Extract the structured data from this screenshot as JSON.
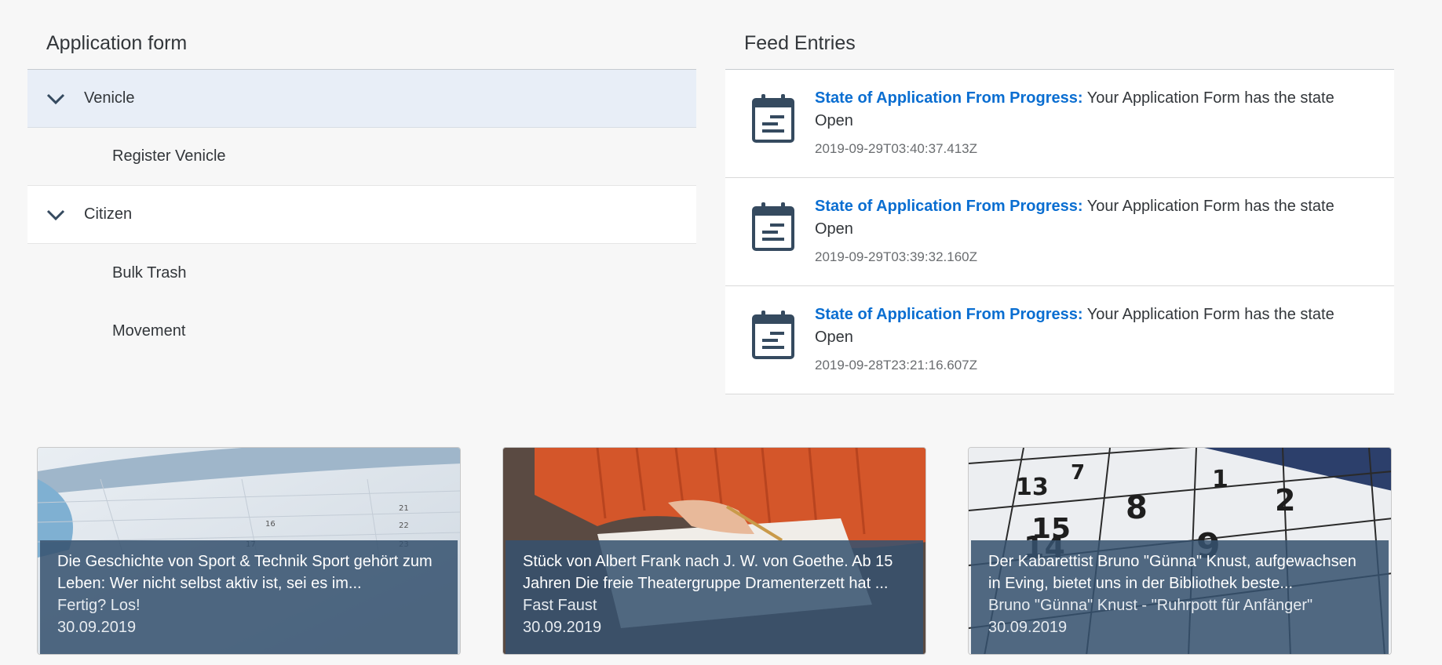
{
  "application_form": {
    "title": "Application form",
    "groups": [
      {
        "label": "Venicle",
        "icon": "chevron-down-icon",
        "items": [
          "Register Venicle"
        ]
      },
      {
        "label": "Citizen",
        "icon": "chevron-down-icon",
        "items": [
          "Bulk Trash",
          "Movement"
        ]
      }
    ]
  },
  "feed": {
    "title": "Feed Entries",
    "entries": [
      {
        "icon": "calendar-icon",
        "sender": "State of Application From Progress:",
        "text": "Your Application Form has the state Open",
        "timestamp": "2019-09-29T03:40:37.413Z"
      },
      {
        "icon": "calendar-icon",
        "sender": "State of Application From Progress:",
        "text": "Your Application Form has the state Open",
        "timestamp": "2019-09-29T03:39:32.160Z"
      },
      {
        "icon": "calendar-icon",
        "sender": "State of Application From Progress:",
        "text": "Your Application Form has the state Open",
        "timestamp": "2019-09-28T23:21:16.607Z"
      }
    ]
  },
  "tiles": [
    {
      "header": "Die Geschichte von Sport & Technik Sport gehört zum Leben: Wer nicht selbst aktiv ist, sei es im...",
      "subheader": "Fertig? Los!",
      "date": "30.09.2019",
      "image": "calendar-page-photo"
    },
    {
      "header": "Stück von Albert Frank nach J. W. von Goethe. Ab 15 Jahren Die freie Theatergruppe Dramenterzett hat ...",
      "subheader": "Fast Faust",
      "date": "30.09.2019",
      "image": "person-writing-photo"
    },
    {
      "header": "Der Kabarettist Bruno \"Günna\" Knust, aufgewachsen in Eving, bietet uns in der Bibliothek beste...",
      "subheader": "Bruno \"Günna\" Knust - \"Ruhrpott für Anfänger\"",
      "date": "30.09.2019",
      "image": "calendar-numbers-photo"
    }
  ],
  "colors": {
    "accent_blue": "#0a6ed1",
    "icon_blue": "#354a5f",
    "selected_row": "#e8eef7",
    "tile_footer": "#35526f"
  }
}
